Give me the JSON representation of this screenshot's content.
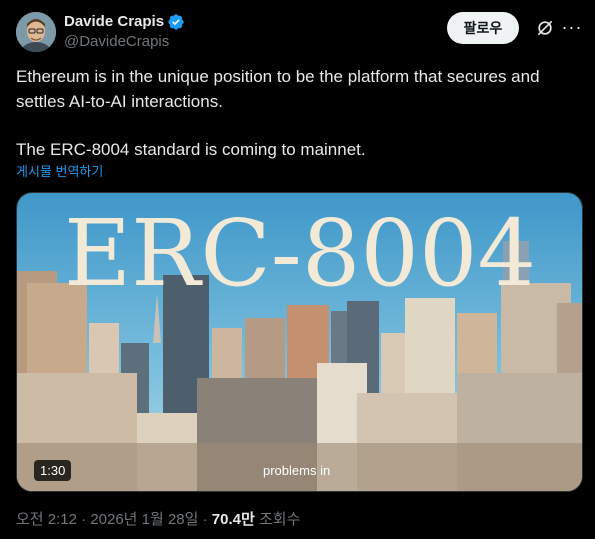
{
  "author": {
    "display_name": "Davide Crapis",
    "handle": "@DavideCrapis"
  },
  "actions": {
    "follow_label": "팔로우",
    "more_label": "···"
  },
  "tweet": {
    "paragraph1": "Ethereum is in the unique position to be the platform that secures and settles AI-to-AI interactions.",
    "paragraph2": "The ERC-8004 standard is coming to mainnet.",
    "translate_label": "게시물 번역하기"
  },
  "media": {
    "overlay_title": "ERC-8004",
    "duration": "1:30",
    "caption": "problems in"
  },
  "meta": {
    "time": "오전 2:12",
    "separator1": " · ",
    "date": "2026년 1월 28일",
    "separator2": " · ",
    "views_count": "70.4만",
    "views_label": " 조회수"
  },
  "colors": {
    "background": "#000000",
    "text_primary": "#e7e9ea",
    "text_secondary": "#71767b",
    "accent": "#1d9bf0"
  }
}
